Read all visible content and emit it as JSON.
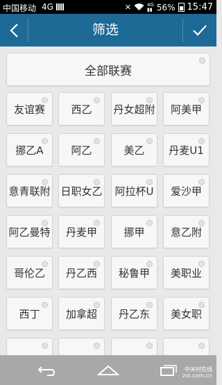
{
  "status_bar": {
    "carrier": "中国移动",
    "network": "4G",
    "battery": "56%",
    "time": "15:47"
  },
  "header": {
    "title": "筛选",
    "back_icon": "chevron-left-icon",
    "confirm_icon": "checkmark-icon"
  },
  "all_leagues": "全部联赛",
  "leagues": [
    "友谊赛",
    "西乙",
    "丹女超附",
    "阿美甲",
    "挪乙A",
    "阿乙",
    "美乙",
    "丹麦U1",
    "意青联附",
    "日职女乙",
    "阿拉杯U",
    "爱沙甲",
    "阿乙曼特",
    "丹麦甲",
    "挪甲",
    "意乙附",
    "哥伦乙",
    "丹乙西",
    "秘鲁甲",
    "美职业",
    "西丁",
    "加拿超",
    "丹乙东",
    "美女职",
    "",
    "",
    "",
    ""
  ],
  "watermark": {
    "line1": "中关村在线",
    "line2": "zol.com.cn"
  },
  "colors": {
    "header": "#1c6a95",
    "background": "#e9e9e9",
    "chip": "#f7f7f7",
    "navbar": "#a8a8a8"
  }
}
